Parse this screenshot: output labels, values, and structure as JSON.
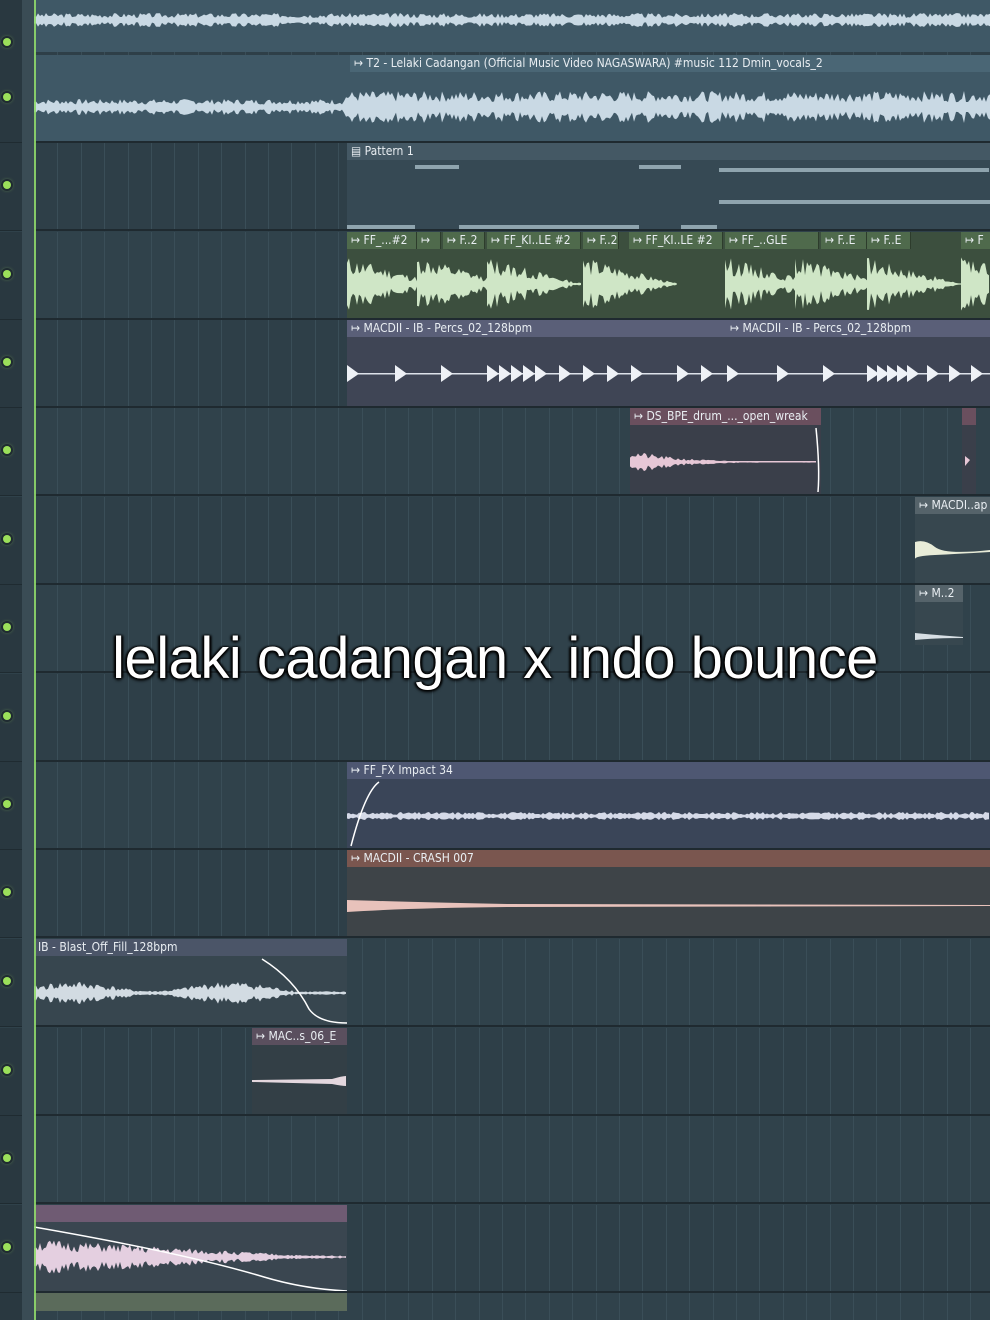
{
  "app": "FL Studio Playlist",
  "colors": {
    "lane_bg": "#2f414a",
    "header_bg": "#293840",
    "led": "#9be05a",
    "vocal_clip": "#3f5866",
    "vocal_wave": "#c9d9e4",
    "pattern_clip": "#3b4f5a",
    "kick_clip": "#435a44",
    "kick_wave": "#cfe6c6",
    "perc_clip": "#4a4f63",
    "drum_clip": "#5b4652",
    "drum_wave": "#e6c7d6",
    "fx_clip": "#48506a",
    "crash_clip": "#6b4a47",
    "crash_wave": "#e8c2bb",
    "fill_clip": "#4b5568"
  },
  "clips": {
    "vocals_title": "T2 - Lelaki Cadangan (Official Music Video NAGASWARA) #music 112 Dmin_vocals_2",
    "pattern_title": "Pattern 1",
    "kick_titles": [
      "FF_...#2",
      "",
      "F..2",
      "FF_KI..LE #2",
      "F..2",
      "FF_KI..LE #2",
      "FF_..GLE",
      "F..E",
      "F..E",
      "F"
    ],
    "perc_title_1": "MACDII - IB - Percs_02_128bpm",
    "perc_title_2": "MACDII - IB - Percs_02_128bpm",
    "drum_title": "DS_BPE_drum_..._open_wreak",
    "macdi_ap_title": "MACDI..ap",
    "m2_title": "M..2",
    "fx_title": "FF_FX Impact 34",
    "crash_title": "MACDII - CRASH 007",
    "fill_title": "IB - Blast_Off_Fill_128bpm",
    "mac_small_title": "MAC..s_06_E",
    "bottom_title": ""
  },
  "caption": "lelaki cadangan x indo bounce"
}
